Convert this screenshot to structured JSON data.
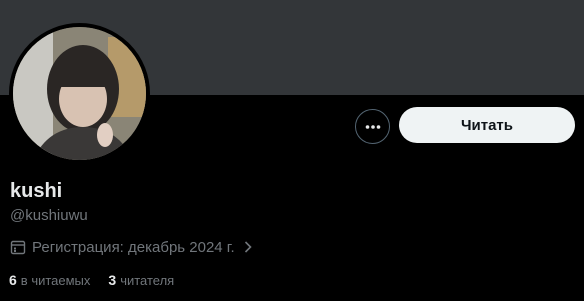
{
  "profile": {
    "display_name": "kushi",
    "handle": "@kushiuwu",
    "joined": "Регистрация: декабрь 2024 г.",
    "following_count": "6",
    "following_label": "в читаемых",
    "followers_count": "3",
    "followers_label": "читателя"
  },
  "actions": {
    "follow_label": "Читать",
    "more_icon": "more-horizontal-icon"
  },
  "icons": {
    "calendar": "calendar-icon",
    "chevron": "chevron-right-icon"
  },
  "colors": {
    "background": "#000000",
    "banner": "#333639",
    "primary_text": "#e7e9ea",
    "secondary_text": "#71767b",
    "follow_button_bg": "#eff3f4",
    "follow_button_text": "#0f1419"
  }
}
